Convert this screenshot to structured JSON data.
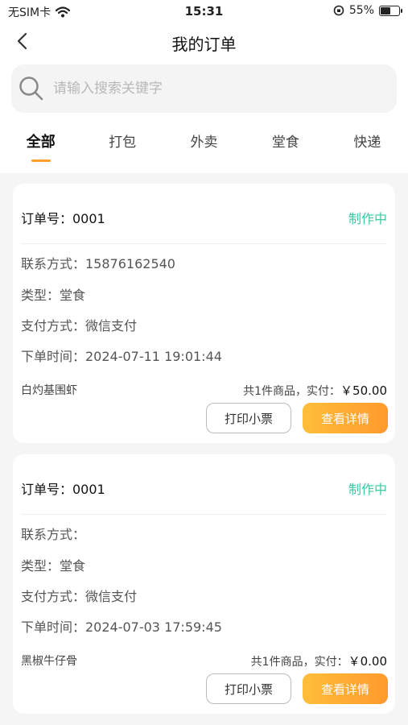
{
  "status_bar": {
    "carrier": "无SIM卡",
    "time": "15:31",
    "battery": "55%",
    "battery_level": 0.55
  },
  "nav": {
    "title": "我的订单"
  },
  "search": {
    "placeholder": "请输入搜索关键字"
  },
  "tabs": [
    {
      "label": "全部",
      "active": true
    },
    {
      "label": "打包"
    },
    {
      "label": "外卖"
    },
    {
      "label": "堂食"
    },
    {
      "label": "快递"
    }
  ],
  "colors": {
    "accent": "#ff9d2e",
    "status_green": "#3fc9a1"
  },
  "orders": [
    {
      "order_no": "订单号：0001",
      "status": "制作中",
      "contact": "联系方式：15876162540",
      "type": "类型：堂食",
      "payment": "支付方式：微信支付",
      "order_time": "下单时间：2024-07-11 19:01:44",
      "item_name": "白灼基围虾",
      "summary_prefix": "共1件商品，实付：",
      "amount": "￥50.00",
      "print_label": "打印小票",
      "detail_label": "查看详情"
    },
    {
      "order_no": "订单号：0001",
      "status": "制作中",
      "contact": "联系方式：",
      "type": "类型：堂食",
      "payment": "支付方式：微信支付",
      "order_time": "下单时间：2024-07-03 17:59:45",
      "item_name": "黑椒牛仔骨",
      "summary_prefix": "共1件商品，实付：",
      "amount": "￥0.00",
      "print_label": "打印小票",
      "detail_label": "查看详情"
    }
  ]
}
